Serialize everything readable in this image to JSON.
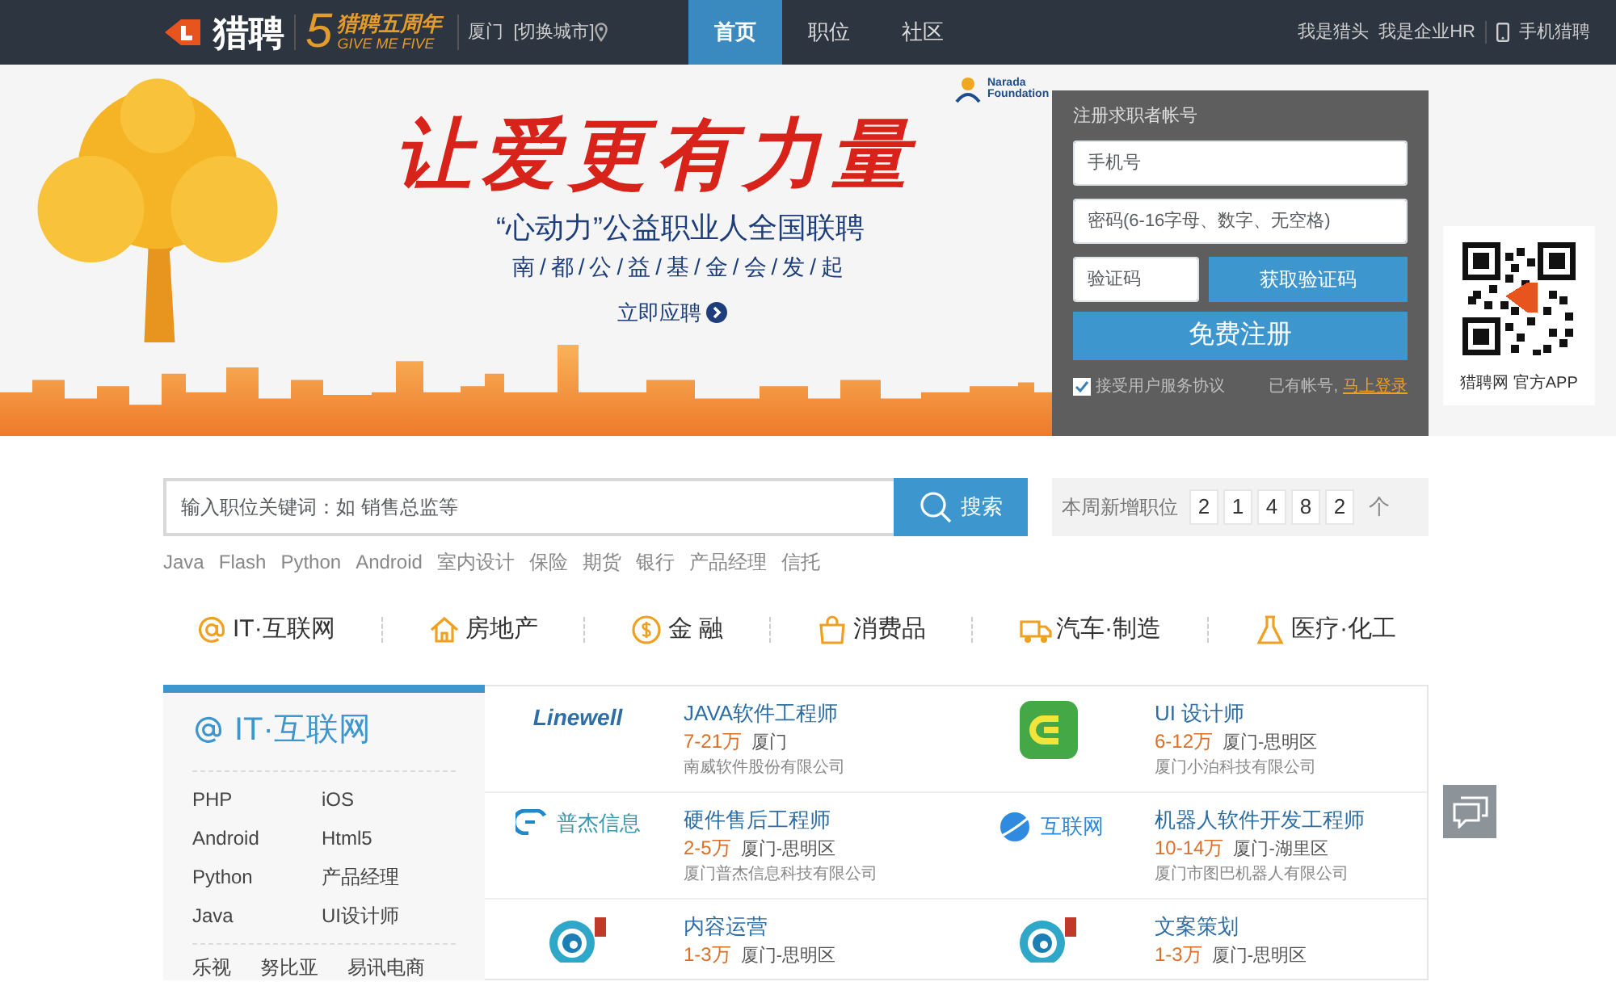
{
  "header": {
    "brand": "猎聘",
    "anniversary_number": "5",
    "anniversary_title": "猎聘五周年",
    "anniversary_slogan": "GIVE ME FIVE",
    "city": "厦门",
    "city_switch": "[切换城市]",
    "tabs": [
      {
        "label": "首页",
        "selected": true
      },
      {
        "label": "职位",
        "selected": false
      },
      {
        "label": "社区",
        "selected": false
      }
    ],
    "links": [
      "我是猎头",
      "我是企业HR"
    ],
    "mobile_link": "手机猎聘"
  },
  "banner": {
    "sponsor": "Narada Foundation",
    "headline": "让爱更有力量",
    "subtitle": "“心动力”公益职业人全国联聘",
    "initiator": "南/都/公/益/基/金/会/发/起",
    "cta": "立即应聘"
  },
  "register": {
    "title": "注册求职者帐号",
    "phone_placeholder": "手机号",
    "password_placeholder": "密码(6-16字母、数字、无空格)",
    "code_placeholder": "验证码",
    "code_button": "获取验证码",
    "submit": "免费注册",
    "agree_label": "接受用户服务协议",
    "agree_checked": true,
    "login_prompt": "已有帐号,",
    "login_link": "马上登录"
  },
  "app": {
    "caption": "猎聘网 官方APP"
  },
  "search": {
    "placeholder": "输入职位关键词：如 销售总监等",
    "button": "搜索",
    "hot_tags": [
      "Java",
      "Flash",
      "Python",
      "Android",
      "室内设计",
      "保险",
      "期货",
      "银行",
      "产品经理",
      "信托"
    ]
  },
  "weekly": {
    "label": "本周新增职位",
    "digits": [
      "2",
      "1",
      "4",
      "8",
      "2"
    ],
    "unit": "个"
  },
  "industries": [
    {
      "kind": "at",
      "label": "IT·互联网"
    },
    {
      "kind": "house",
      "label": "房地产"
    },
    {
      "kind": "coin",
      "label": "金 融"
    },
    {
      "kind": "bag",
      "label": "消费品"
    },
    {
      "kind": "truck",
      "label": "汽车·制造"
    },
    {
      "kind": "flask",
      "label": "医疗·化工"
    }
  ],
  "category_panel": {
    "title": "IT·互联网",
    "skills": [
      "PHP",
      "iOS",
      "Android",
      "Html5",
      "Python",
      "产品经理",
      "Java",
      "UI设计师"
    ],
    "companies": [
      "乐视",
      "努比亚",
      "易讯电商"
    ]
  },
  "jobs": [
    {
      "kind": "wordmark",
      "logo_text": "Linewell",
      "title": "JAVA软件工程师",
      "salary": "7-21万",
      "location": "厦门",
      "company": "南威软件股份有限公司"
    },
    {
      "kind": "green-app",
      "title": "UI 设计师",
      "salary": "6-12万",
      "location": "厦门-思明区",
      "company": "厦门小泊科技有限公司"
    },
    {
      "kind": "bracket",
      "logo_text": "普杰信息",
      "title": "硬件售后工程师",
      "salary": "2-5万",
      "location": "厦门-思明区",
      "company": "厦门普杰信息科技有限公司"
    },
    {
      "kind": "planet",
      "logo_text": "互联网",
      "title": "机器人软件开发工程师",
      "salary": "10-14万",
      "location": "厦门-湖里区",
      "company": "厦门市图巴机器人有限公司"
    },
    {
      "kind": "spiral",
      "title": "内容运营",
      "salary": "1-3万",
      "location": "厦门-思明区"
    },
    {
      "kind": "spiral",
      "title": "文案策划",
      "salary": "1-3万",
      "location": "厦门-思明区"
    }
  ]
}
